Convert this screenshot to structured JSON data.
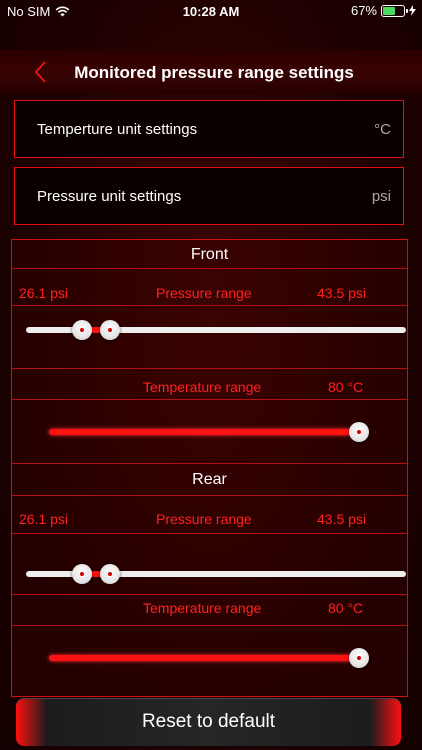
{
  "status_bar": {
    "carrier": "No SIM",
    "time": "10:28 AM",
    "battery_percent": "67%",
    "battery_level": 0.67
  },
  "nav": {
    "title": "Monitored pressure range settings",
    "back_icon": "chevron-left-icon"
  },
  "settings": {
    "temperature_unit": {
      "label": "Temperture unit settings",
      "value": "°C"
    },
    "pressure_unit": {
      "label": "Pressure unit settings",
      "value": "psi"
    }
  },
  "front": {
    "title": "Front",
    "pressure_min": "26.1 psi",
    "pressure_label": "Pressure range",
    "pressure_max": "43.5 psi",
    "temperature_label": "Temperature range",
    "temperature_value": "80 °C"
  },
  "rear": {
    "title": "Rear",
    "pressure_min": "26.1 psi",
    "pressure_label": "Pressure range",
    "pressure_max": "43.5 psi",
    "temperature_label": "Temperature range",
    "temperature_value": "80 °C"
  },
  "reset_label": "Reset to default",
  "colors": {
    "accent": "#ff1111",
    "background": "#1e0101"
  }
}
